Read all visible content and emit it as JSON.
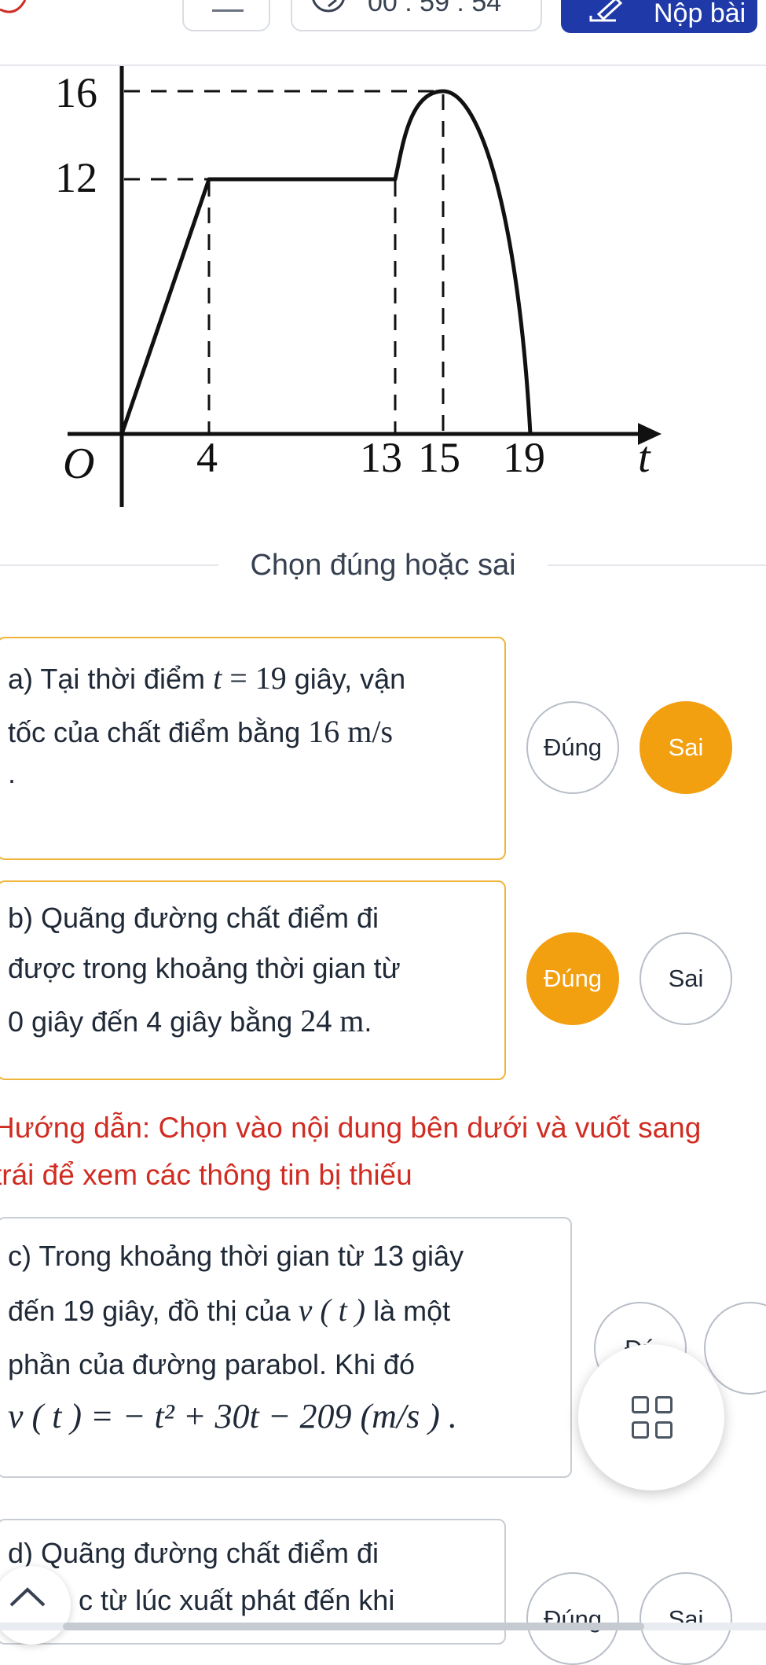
{
  "toolbar": {
    "timer_text": "00 : 59 : 54",
    "submit_label": "Nộp bài"
  },
  "graph": {
    "y_ticks": [
      "16",
      "12"
    ],
    "origin_label": "O",
    "x_ticks": [
      "4",
      "13",
      "15",
      "19"
    ],
    "x_axis_label": "t"
  },
  "section_title": "Chọn đúng hoặc sai",
  "questions": [
    {
      "prefix": "a)",
      "line1_text": "Tại thời điểm ",
      "line1_math_var": "t",
      "line1_math_rest": " = 19",
      "line1_after": " giây, vận",
      "line2_text": "tốc của chất điểm bằng ",
      "line2_math": "16 m/s",
      "line3_text": ".",
      "true_label": "Đúng",
      "false_label": "Sai",
      "selected": "Sai"
    },
    {
      "prefix": "b)",
      "line1_text": "Quãng đường chất điểm đi",
      "line2_text": "được trong khoảng thời gian từ",
      "line3_text": "0 giây đến 4 giây bằng ",
      "line3_math": "24 m",
      "line3_after": ".",
      "true_label": "Đúng",
      "false_label": "Sai",
      "selected": "Đúng"
    },
    {
      "prefix": "c)",
      "line1_text": "Trong khoảng thời gian từ 13 giây",
      "line2_text": "đến 19 giây, đồ thị của ",
      "line2_math": "v ( t )",
      "line2_after": " là một",
      "line3_text": "phần của đường parabol. Khi đó",
      "line4_math": "v ( t ) = − t² + 30t − 209 (m/s ) .",
      "true_label": "Đú",
      "false_label": ""
    },
    {
      "prefix": "d)",
      "line1_text": "Quãng đường chất điểm đi",
      "line2_text": "c từ lúc xuất phát đến khi",
      "true_label": "Đúng",
      "false_label": "Sai"
    }
  ],
  "hint_text": "Hướng dẫn: Chọn vào nội dung bên dưới và vuốt sang trái để xem các thông tin bị thiếu",
  "colors": {
    "accent_orange": "#f29f10",
    "card_border_orange": "#f0b43a",
    "hint_red": "#d02c22",
    "primary_blue": "#1f3aa8"
  }
}
